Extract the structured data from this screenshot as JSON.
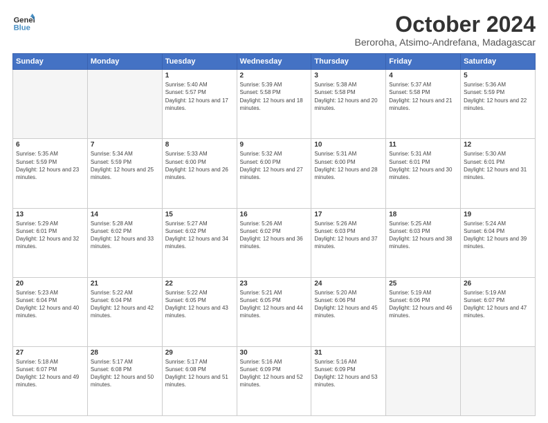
{
  "logo": {
    "line1": "General",
    "line2": "Blue"
  },
  "title": "October 2024",
  "subtitle": "Beroroha, Atsimo-Andrefana, Madagascar",
  "days_of_week": [
    "Sunday",
    "Monday",
    "Tuesday",
    "Wednesday",
    "Thursday",
    "Friday",
    "Saturday"
  ],
  "weeks": [
    [
      {
        "day": "",
        "empty": true
      },
      {
        "day": "",
        "empty": true
      },
      {
        "day": "1",
        "sunrise": "5:40 AM",
        "sunset": "5:57 PM",
        "daylight": "12 hours and 17 minutes."
      },
      {
        "day": "2",
        "sunrise": "5:39 AM",
        "sunset": "5:58 PM",
        "daylight": "12 hours and 18 minutes."
      },
      {
        "day": "3",
        "sunrise": "5:38 AM",
        "sunset": "5:58 PM",
        "daylight": "12 hours and 20 minutes."
      },
      {
        "day": "4",
        "sunrise": "5:37 AM",
        "sunset": "5:58 PM",
        "daylight": "12 hours and 21 minutes."
      },
      {
        "day": "5",
        "sunrise": "5:36 AM",
        "sunset": "5:59 PM",
        "daylight": "12 hours and 22 minutes."
      }
    ],
    [
      {
        "day": "6",
        "sunrise": "5:35 AM",
        "sunset": "5:59 PM",
        "daylight": "12 hours and 23 minutes."
      },
      {
        "day": "7",
        "sunrise": "5:34 AM",
        "sunset": "5:59 PM",
        "daylight": "12 hours and 25 minutes."
      },
      {
        "day": "8",
        "sunrise": "5:33 AM",
        "sunset": "6:00 PM",
        "daylight": "12 hours and 26 minutes."
      },
      {
        "day": "9",
        "sunrise": "5:32 AM",
        "sunset": "6:00 PM",
        "daylight": "12 hours and 27 minutes."
      },
      {
        "day": "10",
        "sunrise": "5:31 AM",
        "sunset": "6:00 PM",
        "daylight": "12 hours and 28 minutes."
      },
      {
        "day": "11",
        "sunrise": "5:31 AM",
        "sunset": "6:01 PM",
        "daylight": "12 hours and 30 minutes."
      },
      {
        "day": "12",
        "sunrise": "5:30 AM",
        "sunset": "6:01 PM",
        "daylight": "12 hours and 31 minutes."
      }
    ],
    [
      {
        "day": "13",
        "sunrise": "5:29 AM",
        "sunset": "6:01 PM",
        "daylight": "12 hours and 32 minutes."
      },
      {
        "day": "14",
        "sunrise": "5:28 AM",
        "sunset": "6:02 PM",
        "daylight": "12 hours and 33 minutes."
      },
      {
        "day": "15",
        "sunrise": "5:27 AM",
        "sunset": "6:02 PM",
        "daylight": "12 hours and 34 minutes."
      },
      {
        "day": "16",
        "sunrise": "5:26 AM",
        "sunset": "6:02 PM",
        "daylight": "12 hours and 36 minutes."
      },
      {
        "day": "17",
        "sunrise": "5:26 AM",
        "sunset": "6:03 PM",
        "daylight": "12 hours and 37 minutes."
      },
      {
        "day": "18",
        "sunrise": "5:25 AM",
        "sunset": "6:03 PM",
        "daylight": "12 hours and 38 minutes."
      },
      {
        "day": "19",
        "sunrise": "5:24 AM",
        "sunset": "6:04 PM",
        "daylight": "12 hours and 39 minutes."
      }
    ],
    [
      {
        "day": "20",
        "sunrise": "5:23 AM",
        "sunset": "6:04 PM",
        "daylight": "12 hours and 40 minutes."
      },
      {
        "day": "21",
        "sunrise": "5:22 AM",
        "sunset": "6:04 PM",
        "daylight": "12 hours and 42 minutes."
      },
      {
        "day": "22",
        "sunrise": "5:22 AM",
        "sunset": "6:05 PM",
        "daylight": "12 hours and 43 minutes."
      },
      {
        "day": "23",
        "sunrise": "5:21 AM",
        "sunset": "6:05 PM",
        "daylight": "12 hours and 44 minutes."
      },
      {
        "day": "24",
        "sunrise": "5:20 AM",
        "sunset": "6:06 PM",
        "daylight": "12 hours and 45 minutes."
      },
      {
        "day": "25",
        "sunrise": "5:19 AM",
        "sunset": "6:06 PM",
        "daylight": "12 hours and 46 minutes."
      },
      {
        "day": "26",
        "sunrise": "5:19 AM",
        "sunset": "6:07 PM",
        "daylight": "12 hours and 47 minutes."
      }
    ],
    [
      {
        "day": "27",
        "sunrise": "5:18 AM",
        "sunset": "6:07 PM",
        "daylight": "12 hours and 49 minutes."
      },
      {
        "day": "28",
        "sunrise": "5:17 AM",
        "sunset": "6:08 PM",
        "daylight": "12 hours and 50 minutes."
      },
      {
        "day": "29",
        "sunrise": "5:17 AM",
        "sunset": "6:08 PM",
        "daylight": "12 hours and 51 minutes."
      },
      {
        "day": "30",
        "sunrise": "5:16 AM",
        "sunset": "6:09 PM",
        "daylight": "12 hours and 52 minutes."
      },
      {
        "day": "31",
        "sunrise": "5:16 AM",
        "sunset": "6:09 PM",
        "daylight": "12 hours and 53 minutes."
      },
      {
        "day": "",
        "empty": true
      },
      {
        "day": "",
        "empty": true
      }
    ]
  ]
}
